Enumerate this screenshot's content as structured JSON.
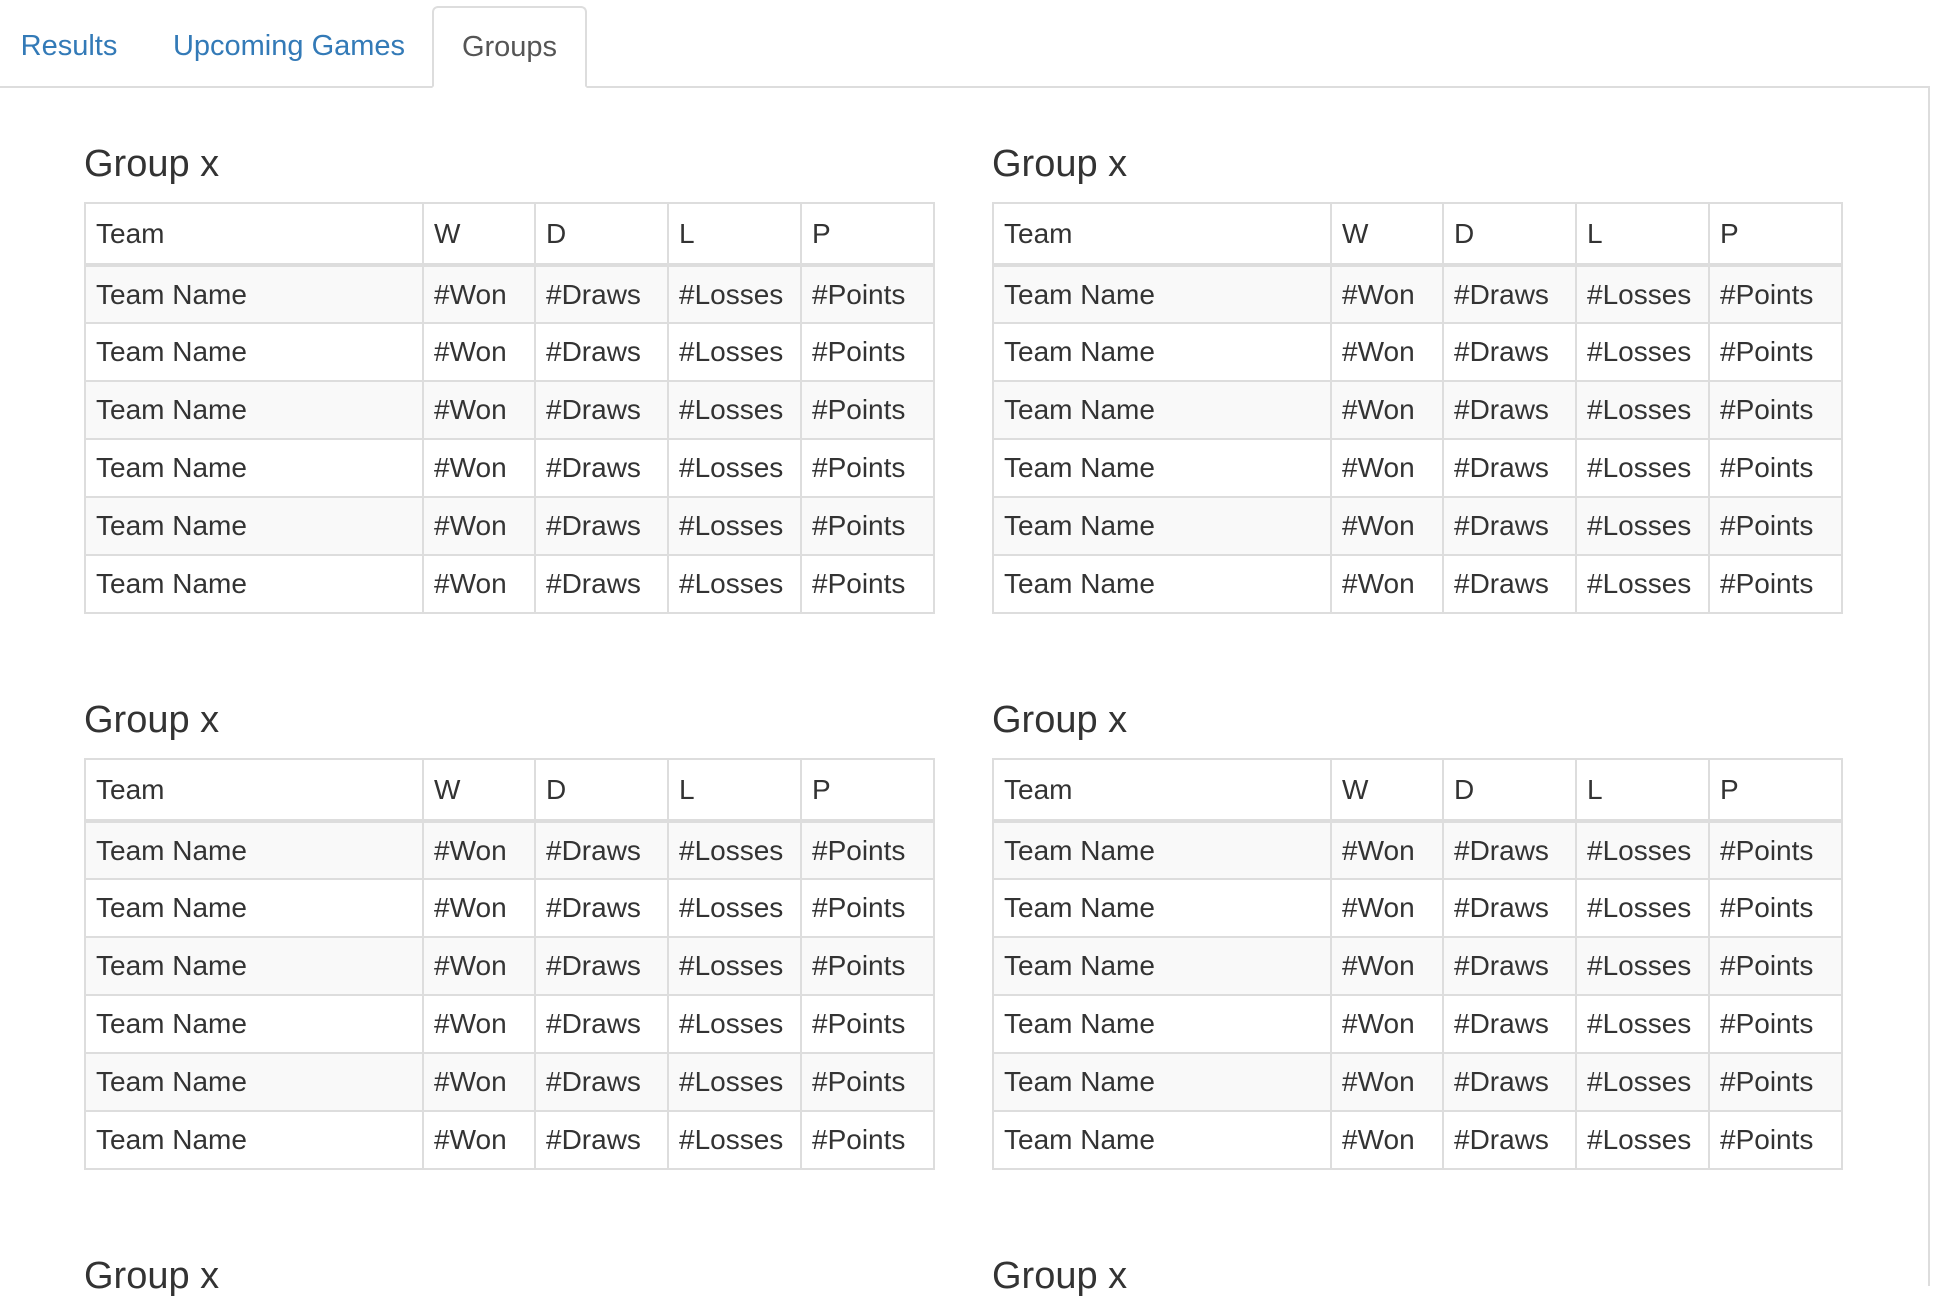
{
  "tabs": [
    {
      "label": "Results",
      "active": false
    },
    {
      "label": "Upcoming Games",
      "active": false
    },
    {
      "label": "Groups",
      "active": true
    }
  ],
  "columns": [
    "Team",
    "W",
    "D",
    "L",
    "P"
  ],
  "groups": [
    {
      "title": "Group x",
      "rows": [
        [
          "Team Name",
          "#Won",
          "#Draws",
          "#Losses",
          "#Points"
        ],
        [
          "Team Name",
          "#Won",
          "#Draws",
          "#Losses",
          "#Points"
        ],
        [
          "Team Name",
          "#Won",
          "#Draws",
          "#Losses",
          "#Points"
        ],
        [
          "Team Name",
          "#Won",
          "#Draws",
          "#Losses",
          "#Points"
        ],
        [
          "Team Name",
          "#Won",
          "#Draws",
          "#Losses",
          "#Points"
        ],
        [
          "Team Name",
          "#Won",
          "#Draws",
          "#Losses",
          "#Points"
        ]
      ]
    },
    {
      "title": "Group x",
      "rows": [
        [
          "Team Name",
          "#Won",
          "#Draws",
          "#Losses",
          "#Points"
        ],
        [
          "Team Name",
          "#Won",
          "#Draws",
          "#Losses",
          "#Points"
        ],
        [
          "Team Name",
          "#Won",
          "#Draws",
          "#Losses",
          "#Points"
        ],
        [
          "Team Name",
          "#Won",
          "#Draws",
          "#Losses",
          "#Points"
        ],
        [
          "Team Name",
          "#Won",
          "#Draws",
          "#Losses",
          "#Points"
        ],
        [
          "Team Name",
          "#Won",
          "#Draws",
          "#Losses",
          "#Points"
        ]
      ]
    },
    {
      "title": "Group x",
      "rows": [
        [
          "Team Name",
          "#Won",
          "#Draws",
          "#Losses",
          "#Points"
        ],
        [
          "Team Name",
          "#Won",
          "#Draws",
          "#Losses",
          "#Points"
        ],
        [
          "Team Name",
          "#Won",
          "#Draws",
          "#Losses",
          "#Points"
        ],
        [
          "Team Name",
          "#Won",
          "#Draws",
          "#Losses",
          "#Points"
        ],
        [
          "Team Name",
          "#Won",
          "#Draws",
          "#Losses",
          "#Points"
        ],
        [
          "Team Name",
          "#Won",
          "#Draws",
          "#Losses",
          "#Points"
        ]
      ]
    },
    {
      "title": "Group x",
      "rows": [
        [
          "Team Name",
          "#Won",
          "#Draws",
          "#Losses",
          "#Points"
        ],
        [
          "Team Name",
          "#Won",
          "#Draws",
          "#Losses",
          "#Points"
        ],
        [
          "Team Name",
          "#Won",
          "#Draws",
          "#Losses",
          "#Points"
        ],
        [
          "Team Name",
          "#Won",
          "#Draws",
          "#Losses",
          "#Points"
        ],
        [
          "Team Name",
          "#Won",
          "#Draws",
          "#Losses",
          "#Points"
        ],
        [
          "Team Name",
          "#Won",
          "#Draws",
          "#Losses",
          "#Points"
        ]
      ]
    },
    {
      "title": "Group x",
      "rows": []
    },
    {
      "title": "Group x",
      "rows": []
    }
  ],
  "colors": {
    "link": "#337ab7",
    "border": "#dddddd",
    "stripe": "#f9f9f9",
    "text": "#333333"
  }
}
